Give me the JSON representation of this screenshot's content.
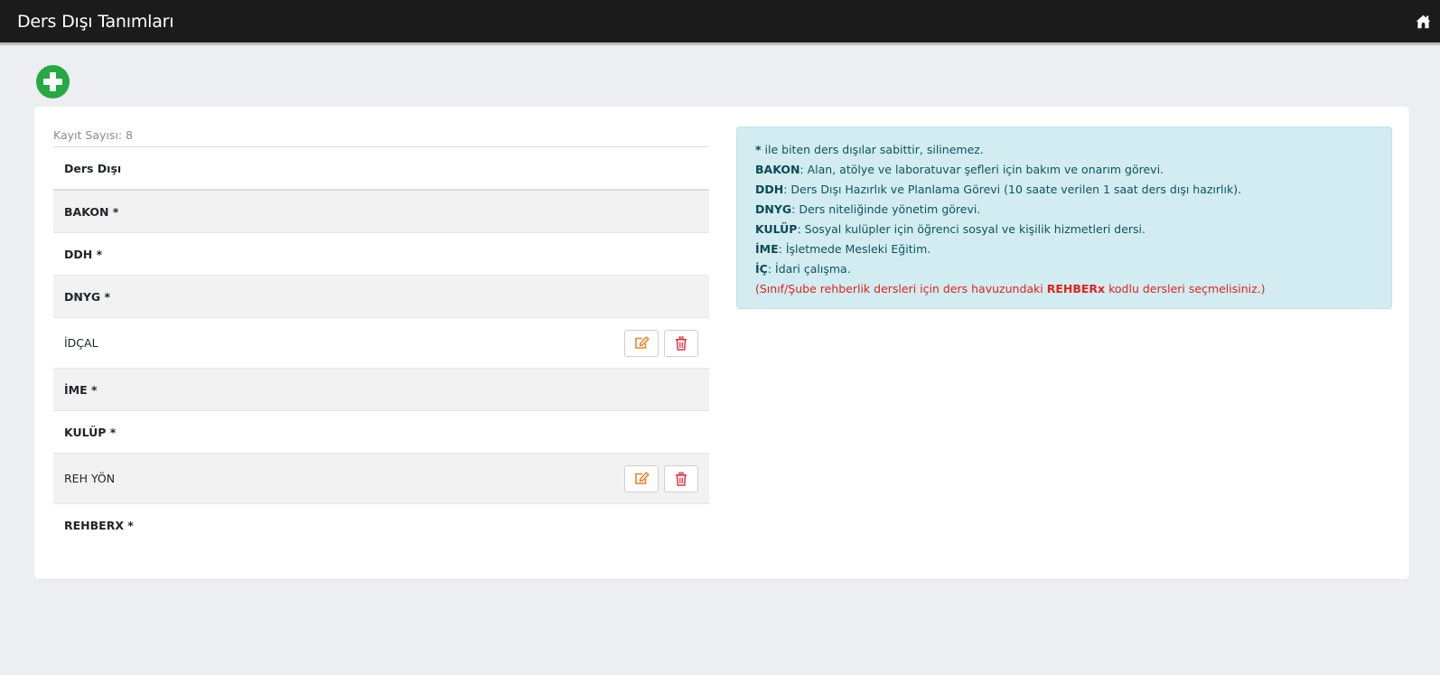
{
  "header": {
    "title": "Ders Dışı Tanımları",
    "home_icon": "home-icon"
  },
  "toolbar": {
    "add_icon": "plus-circle-icon",
    "add_color": "#28a745"
  },
  "list": {
    "record_count_label": "Kayıt Sayısı: 8",
    "column_header": "Ders Dışı",
    "rows": [
      {
        "name": "BAKON *",
        "bold": true,
        "editable": false
      },
      {
        "name": "DDH *",
        "bold": true,
        "editable": false
      },
      {
        "name": "DNYG *",
        "bold": true,
        "editable": false
      },
      {
        "name": "İDÇAL",
        "bold": false,
        "editable": true
      },
      {
        "name": "İME *",
        "bold": true,
        "editable": false
      },
      {
        "name": "KULÜP *",
        "bold": true,
        "editable": false
      },
      {
        "name": "REH YÖN",
        "bold": false,
        "editable": true
      },
      {
        "name": "REHBERX *",
        "bold": true,
        "editable": false
      }
    ],
    "edit_icon": "edit-icon",
    "delete_icon": "trash-icon",
    "edit_color": "#e8832a",
    "delete_color": "#dc3545"
  },
  "info": {
    "line0_term": "*",
    "line0_text": " ile biten ders dışılar sabittir, silinemez.",
    "line1_term": "BAKON",
    "line1_text": ": Alan, atölye ve laboratuvar şefleri için bakım ve onarım görevi.",
    "line2_term": "DDH",
    "line2_text": ": Ders Dışı Hazırlık ve Planlama Görevi (10 saate verilen 1 saat ders dışı hazırlık).",
    "line3_term": "DNYG",
    "line3_text": ": Ders niteliğinde yönetim görevi.",
    "line4_term": "KULÜP",
    "line4_text": ": Sosyal kulüpler için öğrenci sosyal ve kişilik hizmetleri dersi.",
    "line5_term": "İME",
    "line5_text": ": İşletmede Mesleki Eğitim.",
    "line6_term": "İÇ",
    "line6_text": ": İdari çalışma.",
    "warning_before": "(Sınıf/Şube rehberlik dersleri için ders havuzundaki ",
    "warning_term": "REHBERx",
    "warning_after": " kodlu dersleri seçmelisiniz.)",
    "warning_color": "#e0231f"
  }
}
